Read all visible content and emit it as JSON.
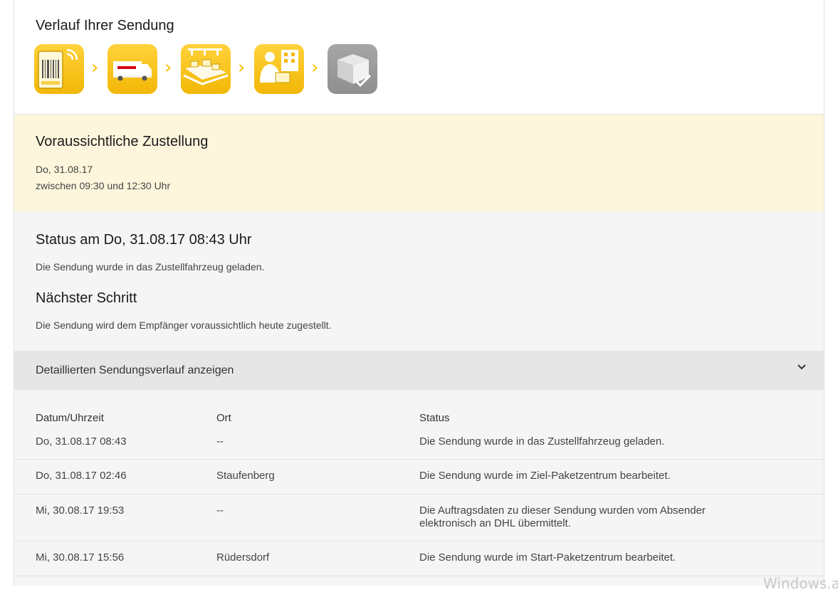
{
  "progress": {
    "title": "Verlauf Ihrer Sendung",
    "steps": [
      {
        "icon": "parcel-label-icon",
        "state": "completed"
      },
      {
        "icon": "truck-icon",
        "state": "completed"
      },
      {
        "icon": "conveyor-icon",
        "state": "completed"
      },
      {
        "icon": "courier-icon",
        "state": "current"
      },
      {
        "icon": "delivered-box-icon",
        "state": "pending"
      }
    ]
  },
  "estimate": {
    "title": "Voraussichtliche Zustellung",
    "date": "Do, 31.08.17",
    "window": "zwischen 09:30 und 12:30 Uhr"
  },
  "status": {
    "title": "Status am Do, 31.08.17 08:43 Uhr",
    "text": "Die Sendung wurde in das Zustellfahrzeug geladen.",
    "next_title": "Nächster Schritt",
    "next_text": "Die Sendung wird dem Empfänger voraussichtlich heute zugestellt."
  },
  "history_toggle": {
    "label": "Detaillierten Sendungsverlauf anzeigen"
  },
  "history": {
    "headers": {
      "datetime": "Datum/Uhrzeit",
      "location": "Ort",
      "status": "Status"
    },
    "rows": [
      {
        "datetime": "Do, 31.08.17 08:43",
        "location": "--",
        "status": "Die Sendung wurde in das Zustellfahrzeug geladen."
      },
      {
        "datetime": "Do, 31.08.17 02:46",
        "location": "Staufenberg",
        "status": "Die Sendung wurde im Ziel-Paketzentrum bearbeitet."
      },
      {
        "datetime": "Mi, 30.08.17 19:53",
        "location": "--",
        "status": "Die Auftragsdaten zu dieser Sendung wurden vom Absender elektronisch an DHL übermittelt."
      },
      {
        "datetime": "Mi, 30.08.17 15:56",
        "location": "Rüdersdorf",
        "status": "Die Sendung wurde im Start-Paketzentrum bearbeitet."
      }
    ]
  },
  "watermark": "Windows.ak",
  "colors": {
    "accent": "#f2b705",
    "estimate_bg": "#fdf6dc",
    "pending_grey": "#999999",
    "dhl_red": "#d40511"
  }
}
